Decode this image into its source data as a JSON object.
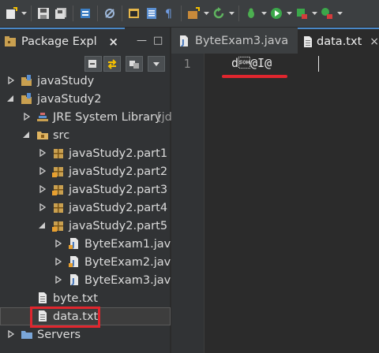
{
  "toolbar": {
    "icons": [
      "new-icon",
      "save-icon",
      "save-all-icon",
      "print-icon",
      "skip-breakpoints-icon",
      "open-type-icon",
      "task-icon",
      "pilcrow-icon",
      "new-java-project-icon",
      "refresh-icon",
      "debug-icon",
      "run-icon",
      "run-external-icon",
      "external-tools-icon"
    ]
  },
  "package_explorer": {
    "title": "Package Expl",
    "close": "×",
    "minimize": "—",
    "maximize": "□",
    "tree": [
      {
        "label": "javaStudy",
        "icon": "java-project-icon",
        "expanded": false
      },
      {
        "label": "javaStudy2",
        "icon": "java-project-icon",
        "expanded": true
      },
      {
        "label": "JRE System Library",
        "suffix": "[jd",
        "icon": "library-icon",
        "expanded": false
      },
      {
        "label": "src",
        "icon": "source-folder-icon",
        "expanded": true
      },
      {
        "label": "javaStudy2.part1",
        "icon": "package-icon",
        "expanded": false
      },
      {
        "label": "javaStudy2.part2",
        "icon": "package-icon",
        "expanded": false
      },
      {
        "label": "javaStudy2.part3",
        "icon": "package-icon",
        "expanded": false
      },
      {
        "label": "javaStudy2.part4",
        "icon": "package-icon",
        "expanded": false
      },
      {
        "label": "javaStudy2.part5",
        "icon": "package-icon",
        "expanded": true
      },
      {
        "label": "ByteExam1.java",
        "icon": "java-file-icon",
        "expanded": false
      },
      {
        "label": "ByteExam2.java",
        "icon": "java-file-icon",
        "expanded": false
      },
      {
        "label": "ByteExam3.java",
        "icon": "java-file-icon",
        "expanded": false
      },
      {
        "label": "byte.txt",
        "icon": "text-file-icon"
      },
      {
        "label": "data.txt",
        "icon": "text-file-icon",
        "selected": true
      },
      {
        "label": "Servers",
        "icon": "folder-icon",
        "expanded": false
      }
    ]
  },
  "editor": {
    "tabs": [
      {
        "label": "ByteExam3.java",
        "icon": "java-file-icon",
        "active": false
      },
      {
        "label": "data.txt",
        "icon": "text-file-icon",
        "active": true,
        "close": "×"
      }
    ],
    "line_number": "1",
    "content": "d\u0001@I@"
  },
  "colors": {
    "accent": "#4a88c7",
    "annotation_red": "#e0262e",
    "background": "#2b2b2b"
  }
}
